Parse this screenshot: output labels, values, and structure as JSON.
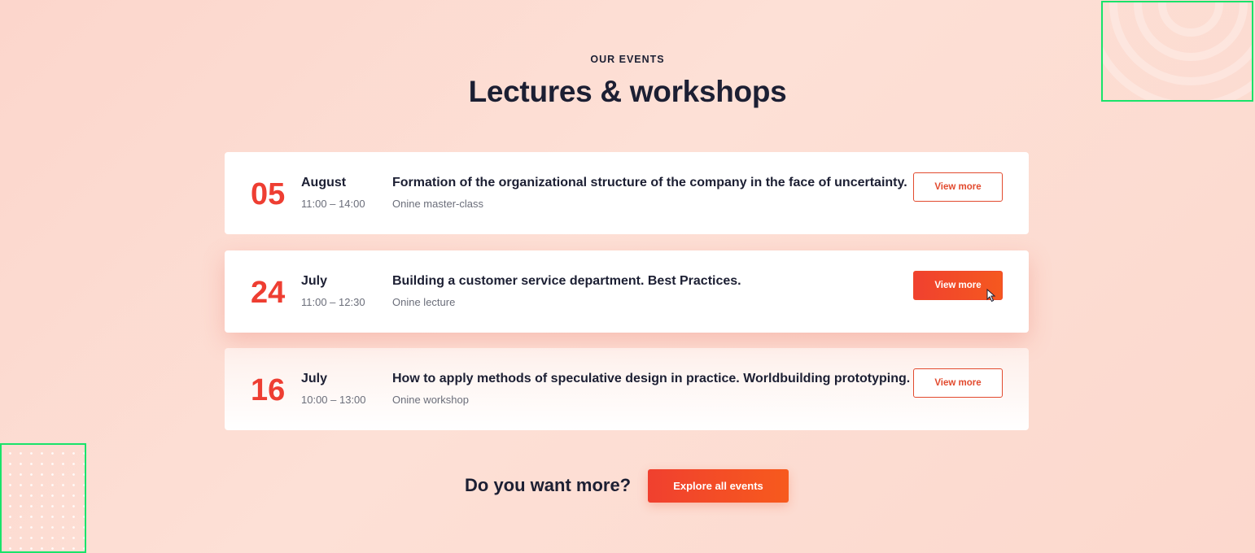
{
  "header": {
    "eyebrow": "OUR EVENTS",
    "title": "Lectures & workshops"
  },
  "events": [
    {
      "day": "05",
      "month": "August",
      "time": "11:00 – 14:00",
      "title": "Formation of the organizational structure of the company in the face of uncertainty.",
      "type": "Onine master-class",
      "button_label": "View more"
    },
    {
      "day": "24",
      "month": "July",
      "time": "11:00 – 12:30",
      "title": "Building a customer service department. Best Practices.",
      "type": "Onine lecture",
      "button_label": "View more"
    },
    {
      "day": "16",
      "month": "July",
      "time": "10:00 – 13:00",
      "title": "How to apply methods of speculative design in practice. Worldbuilding prototyping.",
      "type": "Onine workshop",
      "button_label": "View more"
    }
  ],
  "cta": {
    "question": "Do you want more?",
    "button_label": "Explore all events"
  },
  "colors": {
    "accent": "#ee3e32",
    "button_gradient_start": "#f0412f",
    "button_gradient_end": "#f5581f",
    "heading": "#1c1f33",
    "muted": "#6b6e7a",
    "background": "#fcd6cc",
    "highlight_frame": "#19e36a"
  },
  "icons": {
    "cursor": "pointer-cursor-icon",
    "corner_rings": "concentric-rings-decoration",
    "corner_dots": "dot-grid-decoration"
  }
}
